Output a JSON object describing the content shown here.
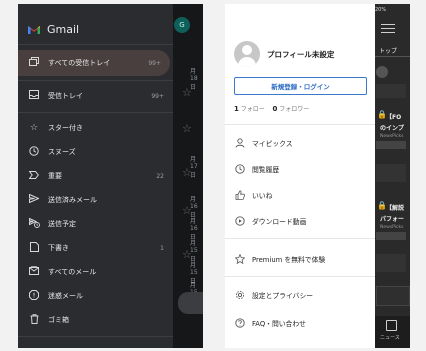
{
  "gmail": {
    "title": "Gmail",
    "logo_icon": "gmail-m-logo",
    "account_initial": "G",
    "items": [
      {
        "label": "すべての受信トレイ",
        "count": "99+",
        "icon": "inbox-stack-icon",
        "selected": true
      },
      {
        "label": "受信トレイ",
        "count": "99+",
        "icon": "inbox-icon"
      },
      {
        "label": "スター付き",
        "count": "",
        "icon": "star-icon"
      },
      {
        "label": "スヌーズ",
        "count": "",
        "icon": "clock-icon"
      },
      {
        "label": "重要",
        "count": "22",
        "icon": "important-icon"
      },
      {
        "label": "送信済みメール",
        "count": "",
        "icon": "send-icon"
      },
      {
        "label": "送信予定",
        "count": "",
        "icon": "scheduled-send-icon"
      },
      {
        "label": "下書き",
        "count": "1",
        "icon": "draft-icon"
      },
      {
        "label": "すべてのメール",
        "count": "",
        "icon": "all-mail-icon"
      },
      {
        "label": "迷惑メール",
        "count": "",
        "icon": "spam-icon"
      },
      {
        "label": "ゴミ箱",
        "count": "",
        "icon": "trash-icon"
      }
    ],
    "background_dates": [
      "月18日",
      "月17日",
      "月16日",
      "月16日",
      "月15日",
      "月15日",
      "月15日"
    ]
  },
  "news": {
    "profile_name": "プロフィール未設定",
    "signup_button": "新規登録・ログイン",
    "follow_count": "1",
    "follow_label": "フォロー",
    "follower_count": "0",
    "follower_label": "フォロワー",
    "menu": [
      {
        "label": "マイピックス",
        "icon": "person-icon"
      },
      {
        "label": "閲覧履歴",
        "icon": "clock-icon"
      },
      {
        "label": "いいね",
        "icon": "thumbs-up-icon"
      },
      {
        "label": "ダウンロード動画",
        "icon": "download-video-icon"
      },
      {
        "label": "Premium を無料で体験",
        "icon": "star-icon"
      },
      {
        "label": "設定とプライバシー",
        "icon": "gear-icon"
      },
      {
        "label": "FAQ・問い合わせ",
        "icon": "question-icon"
      }
    ],
    "background": {
      "status": "20%",
      "tab_top": "トップ",
      "headline1": "【FO",
      "headline1b": "のインプ",
      "source1": "NewsPicks",
      "headline2": "【解説",
      "headline2b": "パフォー",
      "source2": "NewsPicks",
      "tab_news": "ニュース"
    }
  }
}
